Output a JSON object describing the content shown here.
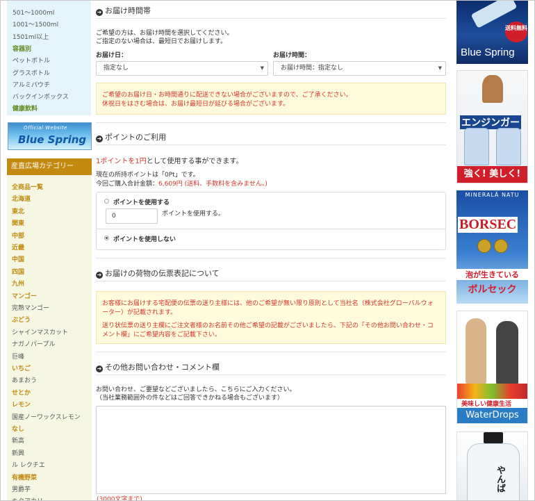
{
  "sidebar": {
    "volume_items": [
      {
        "label": "501〜1000ml",
        "type": "item"
      },
      {
        "label": "1001〜1500ml",
        "type": "item"
      },
      {
        "label": "1501ml以上",
        "type": "item"
      },
      {
        "label": "容器別",
        "type": "head"
      },
      {
        "label": "ペットボトル",
        "type": "item"
      },
      {
        "label": "グラスボトル",
        "type": "item"
      },
      {
        "label": "アルミパウチ",
        "type": "item"
      },
      {
        "label": "バックインボックス",
        "type": "item"
      },
      {
        "label": "健康飲料",
        "type": "head"
      }
    ],
    "banner": {
      "small": "Official Website",
      "big": "Blue Spring"
    },
    "category_header": "産直広場カテゴリー",
    "categories": [
      {
        "label": "全商品一覧",
        "type": "head"
      },
      {
        "label": "北海道",
        "type": "head"
      },
      {
        "label": "東北",
        "type": "head"
      },
      {
        "label": "関東",
        "type": "head"
      },
      {
        "label": "中部",
        "type": "head"
      },
      {
        "label": "近畿",
        "type": "head"
      },
      {
        "label": "中国",
        "type": "head"
      },
      {
        "label": "四国",
        "type": "head"
      },
      {
        "label": "九州",
        "type": "head"
      },
      {
        "label": "マンゴー",
        "type": "head"
      },
      {
        "label": "完熟マンゴー",
        "type": "item"
      },
      {
        "label": "ぶどう",
        "type": "head"
      },
      {
        "label": "シャインマスカット",
        "type": "item"
      },
      {
        "label": "ナガノパープル",
        "type": "item"
      },
      {
        "label": "巨峰",
        "type": "item"
      },
      {
        "label": "いちご",
        "type": "head"
      },
      {
        "label": "あまおう",
        "type": "item"
      },
      {
        "label": "せとか",
        "type": "head"
      },
      {
        "label": "レモン",
        "type": "head"
      },
      {
        "label": "国産ノーワックスレモン",
        "type": "item"
      },
      {
        "label": "なし",
        "type": "head"
      },
      {
        "label": "新高",
        "type": "item"
      },
      {
        "label": "新興",
        "type": "item"
      },
      {
        "label": "ル レクチエ",
        "type": "item"
      },
      {
        "label": "有機野菜",
        "type": "head"
      },
      {
        "label": "男爵芋",
        "type": "item"
      },
      {
        "label": "キタアカリ",
        "type": "item"
      }
    ]
  },
  "delivery": {
    "title": "お届け時間帯",
    "desc1": "ご希望の方は、お届け時間を選択してください。",
    "desc2": "ご指定のない場合は、最短日でお届けします。",
    "date_label": "お届け日：",
    "date_value": "指定なし",
    "time_label": "お届け時間：",
    "time_value": "お届け時間：指定なし",
    "notice1": "ご希望のお届け日・お時間通りに配送できない場合がございますので、ご了承ください。",
    "notice2": "休祝日をはさむ場合は、お届け最短日が延びる場合がございます。"
  },
  "points": {
    "title": "ポイントのご利用",
    "lead_red": "1ポイントを1円",
    "lead_rest": "として使用する事ができます。",
    "current": "現在の所持ポイントは「0Pt」です。",
    "total_label": "今回ご購入合計金額：",
    "total_value": "6,609円 (送料、手数料を含みません。)",
    "use_label": "ポイントを使用する",
    "input_value": "0",
    "input_suffix": "ポイントを使用する。",
    "nouse_label": "ポイントを使用しない"
  },
  "slip": {
    "title": "お届けの荷物の伝票表記について",
    "line1": "お客様にお届けする宅配便の伝票の送り主様には、他のご希望が無い限り原則として当社名（株式会社グローバルウォ",
    "line2": "ーター）が記載されます。",
    "line3": "送り状伝票の送り主欄にご注文者様のお名前その他ご希望の記載がございましたら、下記の「その他お問い合わせ・コ",
    "line4": "メント欄」にご希望内容をご記載下さい。"
  },
  "comment": {
    "title": "その他お問い合わせ・コメント欄",
    "desc1": "お問い合わせ、ご要望などございましたら、こちらにご入力ください。",
    "desc2": "（当社業務範囲外の件などはご回答できかねる場合もございます）",
    "counter": "(3000文字まで)"
  },
  "ads": {
    "blue_spring": {
      "brand": "Blue Spring",
      "badge": "送料無料"
    },
    "ensinger": {
      "name": "エンジンガー",
      "slogan": "強く! 美しく!"
    },
    "borsec": {
      "top": "MINERALĂ NATU",
      "name": "BORSEC",
      "bubble": "泡が生きている",
      "jp": "ボルセック"
    },
    "waterdrops": {
      "tag": "美味しい健康生活",
      "name": "WaterDrops"
    },
    "yanbaru": {
      "kana": "やんば"
    }
  }
}
